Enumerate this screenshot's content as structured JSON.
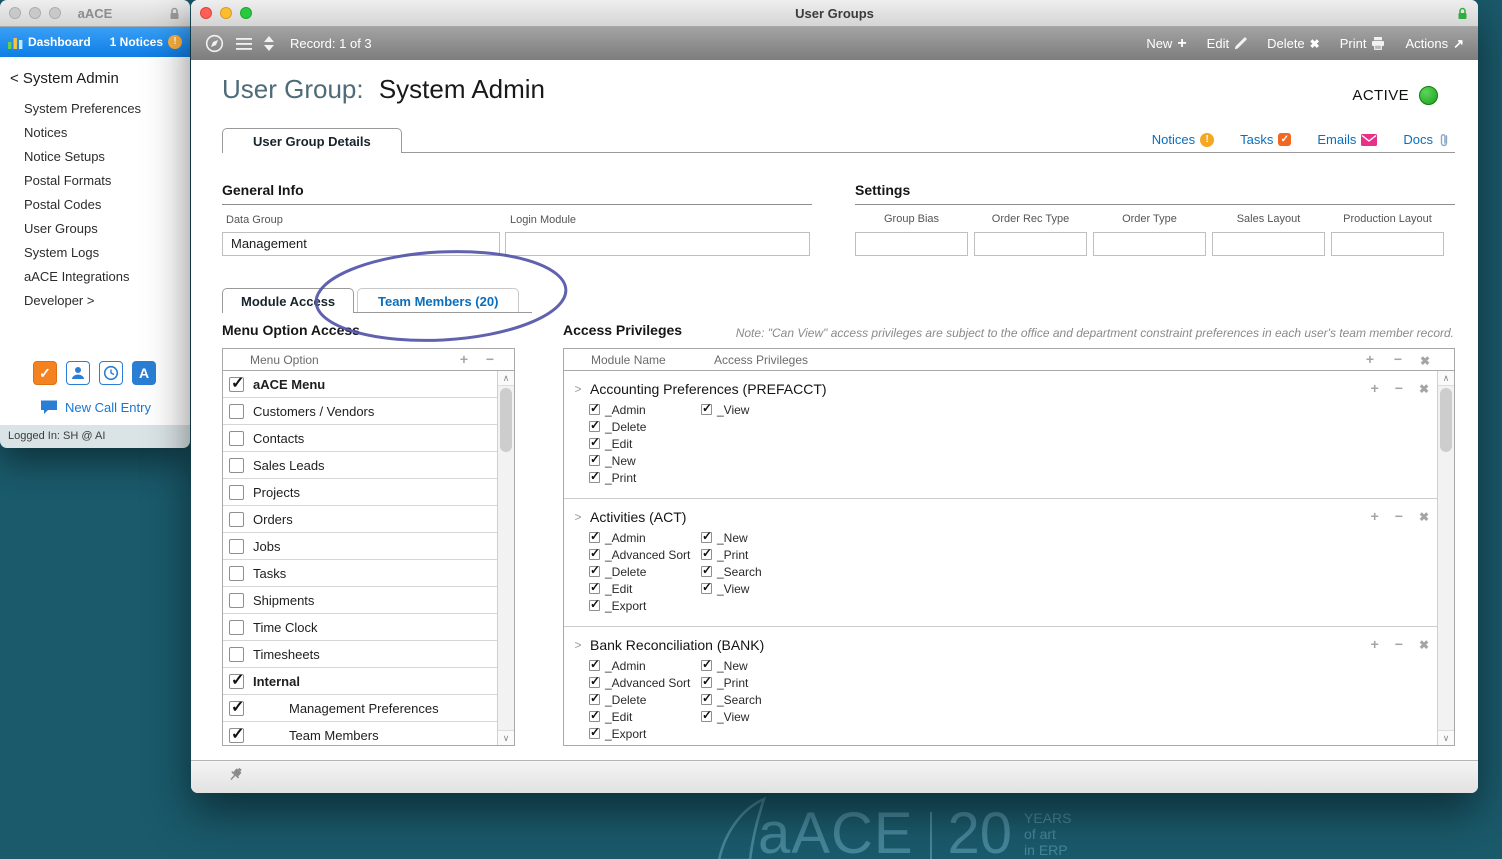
{
  "icons": {
    "plus": "+",
    "minus": "−",
    "close": "✖",
    "check": "✓",
    "warning": "!",
    "arrow_up_right": "↗",
    "scroll_up": "∧",
    "scroll_down": "∨",
    "disclosure": ">",
    "letter_a": "A"
  },
  "colors": {
    "accent_blue": "#0a6ebd",
    "teal_background": "#1a5a6b",
    "status_green": "#2bb52b",
    "notice_orange": "#f5a623",
    "tasks_orange": "#f26722",
    "emails_magenta": "#e8308a",
    "annotation_purple": "#5254a8"
  },
  "desktop_logo": {
    "brand": "aACE",
    "number": "20",
    "years": "YEARS",
    "line2": "of art",
    "line3": "in ERP"
  },
  "sidebar": {
    "title": "aACE",
    "dashboard": "Dashboard",
    "notices_badge": "1 Notices",
    "back_title": "< System Admin",
    "items": [
      "System Preferences",
      "Notices",
      "Notice Setups",
      "Postal Formats",
      "Postal Codes",
      "User Groups",
      "System Logs",
      "aACE Integrations",
      "Developer >"
    ],
    "new_call_entry": "New Call Entry",
    "logged_in": "Logged In: SH @ AI"
  },
  "window": {
    "title": "User Groups",
    "toolbar": {
      "record": "Record: 1 of 3",
      "buttons": [
        "New",
        "Edit",
        "Delete",
        "Print",
        "Actions"
      ]
    },
    "header": {
      "label": "User Group:",
      "value": "System Admin",
      "status": "ACTIVE"
    },
    "detail_tab": "User Group Details",
    "quick_links": {
      "notices": "Notices",
      "tasks": "Tasks",
      "emails": "Emails",
      "docs": "Docs"
    },
    "general_info": {
      "title": "General Info",
      "data_group": {
        "label": "Data Group",
        "value": "Management"
      },
      "login_module": {
        "label": "Login Module",
        "value": ""
      }
    },
    "settings": {
      "title": "Settings",
      "fields": [
        {
          "label": "Group Bias",
          "value": ""
        },
        {
          "label": "Order Rec Type",
          "value": ""
        },
        {
          "label": "Order Type",
          "value": ""
        },
        {
          "label": "Sales Layout",
          "value": ""
        },
        {
          "label": "Production Layout",
          "value": ""
        }
      ]
    },
    "subtabs": {
      "module_access": "Module Access",
      "team_members": "Team Members (20)"
    },
    "menu_access": {
      "title": "Menu Option Access",
      "column": "Menu Option",
      "rows": [
        {
          "label": "aACE Menu",
          "checked": true,
          "bold": true,
          "indent": false
        },
        {
          "label": "Customers / Vendors",
          "checked": false,
          "bold": false,
          "indent": false
        },
        {
          "label": "Contacts",
          "checked": false,
          "bold": false,
          "indent": false
        },
        {
          "label": "Sales Leads",
          "checked": false,
          "bold": false,
          "indent": false
        },
        {
          "label": "Projects",
          "checked": false,
          "bold": false,
          "indent": false
        },
        {
          "label": "Orders",
          "checked": false,
          "bold": false,
          "indent": false
        },
        {
          "label": "Jobs",
          "checked": false,
          "bold": false,
          "indent": false
        },
        {
          "label": "Tasks",
          "checked": false,
          "bold": false,
          "indent": false
        },
        {
          "label": "Shipments",
          "checked": false,
          "bold": false,
          "indent": false
        },
        {
          "label": "Time Clock",
          "checked": false,
          "bold": false,
          "indent": false
        },
        {
          "label": "Timesheets",
          "checked": false,
          "bold": false,
          "indent": false
        },
        {
          "label": "Internal",
          "checked": true,
          "bold": true,
          "indent": false
        },
        {
          "label": "Management Preferences",
          "checked": true,
          "bold": false,
          "indent": true
        },
        {
          "label": "Team Members",
          "checked": true,
          "bold": false,
          "indent": true
        }
      ]
    },
    "access_privileges": {
      "title": "Access Privileges",
      "note": "Note: \"Can View\" access privileges are subject to the office and department constraint preferences in each user's team member record.",
      "col_module": "Module Name",
      "col_privileges": "Access Privileges",
      "groups": [
        {
          "name": "Accounting Preferences  (PREFACCT)",
          "col1": [
            "_Admin",
            "_Delete",
            "_Edit",
            "_New",
            "_Print"
          ],
          "col2": [
            "_View"
          ]
        },
        {
          "name": "Activities  (ACT)",
          "col1": [
            "_Admin",
            "_Advanced Sort",
            "_Delete",
            "_Edit",
            "_Export"
          ],
          "col2": [
            "_New",
            "_Print",
            "_Search",
            "_View"
          ]
        },
        {
          "name": "Bank Reconciliation  (BANK)",
          "col1": [
            "_Admin",
            "_Advanced Sort",
            "_Delete",
            "_Edit",
            "_Export"
          ],
          "col2": [
            "_New",
            "_Print",
            "_Search",
            "_View"
          ]
        }
      ]
    }
  }
}
